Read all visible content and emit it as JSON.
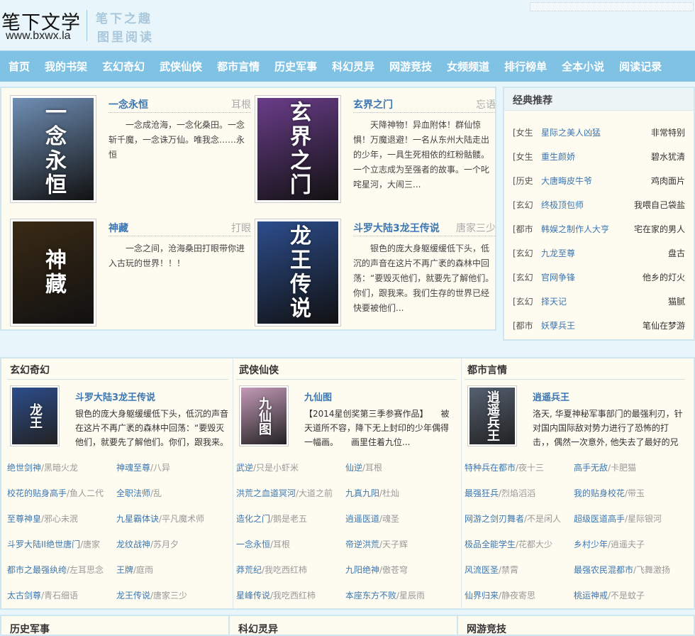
{
  "site": {
    "logo": "笔下文学",
    "url": "www.bxwx.la",
    "slogan1": "笔下之趣",
    "slogan2": "图里阅读"
  },
  "nav": [
    "首页",
    "我的书架",
    "玄幻奇幻",
    "武侠仙侠",
    "都市言情",
    "历史军事",
    "科幻灵异",
    "网游竞技",
    "女频频道",
    "排行榜单",
    "全本小说",
    "阅读记录"
  ],
  "featured": [
    {
      "title": "一念永恒",
      "author": "耳根",
      "cover": "一念永恒",
      "desc": "一念成沧海，一念化桑田。一念斩千魔，一念诛万仙。唯我念……永恒",
      "color": "#6f8fb5"
    },
    {
      "title": "玄界之门",
      "author": "忘语",
      "cover": "玄界之门",
      "desc": "天降神物！异血附体！群仙惊惧！万魔退避！一名从东州大陆走出的少年，一具生死相依的红粉骷髅。一个立志成为至强者的故事。一个叱咤星河，大闹三...",
      "color": "#6a3d8a"
    },
    {
      "title": "神藏",
      "author": "打眼",
      "cover": "神藏",
      "desc": "一念之间，沧海桑田打眼带你进入古玩的世界！！！",
      "color": "#3a2a14"
    },
    {
      "title": "斗罗大陆3龙王传说",
      "author": "唐家三少",
      "cover": "龙王传说",
      "desc": "银色的庞大身躯缓缓低下头，低沉的声音在这片不再广袤的森林中回荡：“要毁灭他们，就要先了解他们。你们，跟我来。我们生存的世界已经快要被他们...",
      "color": "#2c4d8c"
    }
  ],
  "classic": {
    "title": "经典推荐",
    "items": [
      {
        "cat": "[女生",
        "name": "星际之美人凶猛",
        "author": "非常特别"
      },
      {
        "cat": "[女生",
        "name": "重生颜娇",
        "author": "碧水犹清"
      },
      {
        "cat": "[历史",
        "name": "大唐晦皮牛爷",
        "author": "鸡肉面片"
      },
      {
        "cat": "[玄幻",
        "name": "终极顶包师",
        "author": "我喂自己袋盐"
      },
      {
        "cat": "[都市",
        "name": "韩娱之制作人大亨",
        "author": "宅在家的男人"
      },
      {
        "cat": "[玄幻",
        "name": "九龙至尊",
        "author": "盘古"
      },
      {
        "cat": "[玄幻",
        "name": "官网争锋",
        "author": "他乡的灯火"
      },
      {
        "cat": "[玄幻",
        "name": "择天记",
        "author": "猫腻"
      },
      {
        "cat": "[都市",
        "name": "妖孽兵王",
        "author": "笔仙在梦游"
      }
    ]
  },
  "sections": [
    {
      "title": "玄幻奇幻",
      "feat": {
        "title": "斗罗大陆3龙王传说",
        "desc": "银色的庞大身躯缓缓低下头，低沉的声音在这片不再广袤的森林中回荡：“要毁灭他们，就要先了解他们。你们，跟我来。",
        "cover": "龙王",
        "color": "#2c4d8c"
      },
      "items": [
        [
          "绝世剑神",
          "/黑暗火龙"
        ],
        [
          "神魂至尊",
          "/八异"
        ],
        [
          "校花的贴身高手",
          "/鱼人二代"
        ],
        [
          "全职法师",
          "/乱"
        ],
        [
          "至尊神皇",
          "/邪心未泯"
        ],
        [
          "九星霸体诀",
          "/平凡魔术师"
        ],
        [
          "斗罗大陆II绝世唐门",
          "/唐家"
        ],
        [
          "龙纹战神",
          "/苏月夕"
        ],
        [
          "都市之最强纨绔",
          "/左耳思念"
        ],
        [
          "王牌",
          "/庭雨"
        ],
        [
          "太古剑尊",
          "/青石细语"
        ],
        [
          "龙王传说",
          "/唐家三少"
        ]
      ]
    },
    {
      "title": "武侠仙侠",
      "feat": {
        "title": "九仙图",
        "desc": "【2014星创奖第三季参赛作品】　　被天道所不容，降下无上封印的少年偶得一幅画。　　画里住着九位...",
        "cover": "九仙图",
        "color": "#c49ab8"
      },
      "items": [
        [
          "武逆",
          "/只是小虾米"
        ],
        [
          "仙逆",
          "/耳根"
        ],
        [
          "洪荒之血道冥河",
          "/大道之前"
        ],
        [
          "九真九阳",
          "/杜灿"
        ],
        [
          "造化之门",
          "/鹅是老五"
        ],
        [
          "逍遥医道",
          "/魂圣"
        ],
        [
          "一念永恒",
          "/耳根"
        ],
        [
          "帝逆洪荒",
          "/天子辉"
        ],
        [
          "莽荒纪",
          "/我吃西红柿"
        ],
        [
          "九阳绝神",
          "/傲苍穹"
        ],
        [
          "星峰传说",
          "/我吃西红柿"
        ],
        [
          "本座东方不败",
          "/星辰雨"
        ]
      ]
    },
    {
      "title": "都市言情",
      "feat": {
        "title": "逍遥兵王",
        "desc": "洛天, 华夏神秘军事部门的最强利刃，针对国内国际敌对势力进行了恐怖的打击，，偶然一次意外, 他失去了最好的兄",
        "cover": "逍遥兵王",
        "color": "#556070"
      },
      "items": [
        [
          "特种兵在都市",
          "/夜十三"
        ],
        [
          "高手无敌",
          "/卡肥猫"
        ],
        [
          "最强狂兵",
          "/烈焰滔滔"
        ],
        [
          "我的贴身校花",
          "/带玉"
        ],
        [
          "网游之剑刃舞者",
          "/不是闲人"
        ],
        [
          "超级医道高手",
          "/星际银河"
        ],
        [
          "极品全能学生",
          "/花都大少"
        ],
        [
          "乡村少年",
          "/逍遥夫子"
        ],
        [
          "风流医圣",
          "/禁霄"
        ],
        [
          "最强农民混都市",
          "/飞舞激扬"
        ],
        [
          "仙界归来",
          "/静夜寄思"
        ],
        [
          "桃运神戒",
          "/不是蚊子"
        ]
      ]
    }
  ],
  "bottom": [
    "历史军事",
    "科幻灵异",
    "网游竞技"
  ]
}
